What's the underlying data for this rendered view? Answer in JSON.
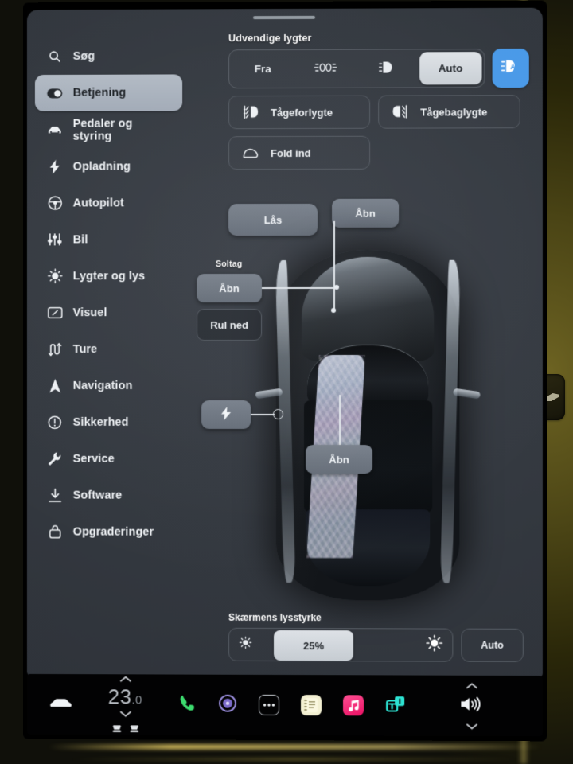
{
  "sidebar": {
    "search": {
      "label": "Søg",
      "icon": "search-icon"
    },
    "items": [
      {
        "label": "Betjening",
        "icon": "toggle-icon",
        "selected": true
      },
      {
        "label": "Pedaler og styring",
        "icon": "car-front-icon",
        "selected": false
      },
      {
        "label": "Opladning",
        "icon": "bolt-icon",
        "selected": false
      },
      {
        "label": "Autopilot",
        "icon": "steering-wheel-icon",
        "selected": false
      },
      {
        "label": "Bil",
        "icon": "sliders-icon",
        "selected": false
      },
      {
        "label": "Lygter og lys",
        "icon": "sun-icon",
        "selected": false
      },
      {
        "label": "Visuel",
        "icon": "display-icon",
        "selected": false
      },
      {
        "label": "Ture",
        "icon": "route-icon",
        "selected": false
      },
      {
        "label": "Navigation",
        "icon": "navigation-arrow-icon",
        "selected": false
      },
      {
        "label": "Sikkerhed",
        "icon": "alert-circle-icon",
        "selected": false
      },
      {
        "label": "Service",
        "icon": "wrench-icon",
        "selected": false
      },
      {
        "label": "Software",
        "icon": "download-icon",
        "selected": false
      },
      {
        "label": "Opgraderinger",
        "icon": "bag-icon",
        "selected": false
      }
    ]
  },
  "exterior_lights": {
    "section_label": "Udvendige lygter",
    "segments": [
      {
        "label": "Fra",
        "icon": "",
        "active": false
      },
      {
        "label": "",
        "icon": "parking-lights-icon",
        "active": false
      },
      {
        "label": "",
        "icon": "headlight-icon",
        "active": false
      },
      {
        "label": "Auto",
        "icon": "",
        "active": true
      }
    ],
    "auto_highbeam": {
      "icon": "auto-highbeam-icon",
      "active": true,
      "color": "#4a9ae8"
    }
  },
  "fog_lights": {
    "front": {
      "label": "Tågeforlygte",
      "icon": "fog-front-icon"
    },
    "rear": {
      "label": "Tågebaglygte",
      "icon": "fog-rear-icon"
    }
  },
  "mirrors": {
    "label": "Fold ind",
    "icon": "mirror-icon"
  },
  "car_controls": {
    "lock": {
      "label": "Lås"
    },
    "frunk": {
      "label": "Åbn"
    },
    "sunroof": {
      "label": "Soltag",
      "open": {
        "label": "Åbn",
        "active": true
      },
      "vent": {
        "label": "Rul ned",
        "active": false
      }
    },
    "charge_port": {
      "icon": "bolt-icon"
    },
    "trunk": {
      "label": "Åbn"
    }
  },
  "brightness": {
    "label": "Skærmens lysstyrke",
    "value": "25%",
    "min_icon": "brightness-low-icon",
    "max_icon": "brightness-high-icon",
    "auto_label": "Auto"
  },
  "taskbar": {
    "car_icon": "car-icon",
    "temperature": "23",
    "temperature_decimal": ".0",
    "seat_left_icon": "seat-heater-icon",
    "seat_right_icon": "seat-heater-icon",
    "apps": [
      {
        "name": "phone-icon",
        "color": "#3ddc6f"
      },
      {
        "name": "media-icon",
        "color": "#8f7fd6"
      },
      {
        "name": "more-dots-icon",
        "color": "#ffffff"
      },
      {
        "name": "notes-icon",
        "color": "#f2efcf"
      },
      {
        "name": "music-icon",
        "color": "#f4257e"
      },
      {
        "name": "toolbox-app-icon",
        "color": "#2de3d3"
      }
    ],
    "volume_icon": "volume-icon"
  }
}
